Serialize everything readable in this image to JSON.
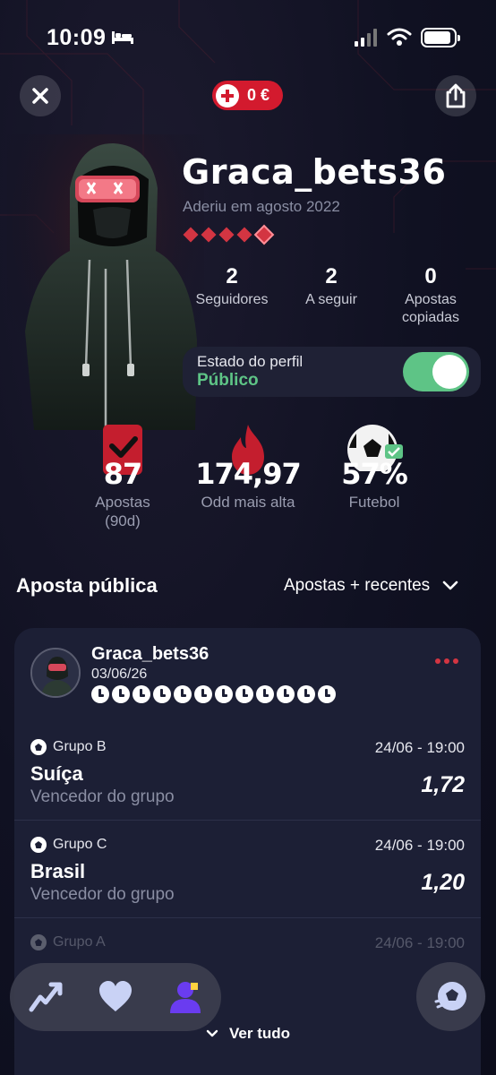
{
  "status_bar": {
    "time": "10:09"
  },
  "header": {
    "balance": "0 €"
  },
  "profile": {
    "username": "Graca_bets36",
    "joined": "Aderiu em agosto 2022",
    "level_filled": 4,
    "level_total": 5
  },
  "stats": [
    {
      "value": "2",
      "label": "Seguidores"
    },
    {
      "value": "2",
      "label": "A seguir"
    },
    {
      "value": "0",
      "label": "Apostas copiadas"
    }
  ],
  "profile_state": {
    "label": "Estado do perfil",
    "value": "Público",
    "toggle_on": true
  },
  "kpis": [
    {
      "value": "87",
      "label": "Apostas (90d)",
      "icon": "ticket-check-icon"
    },
    {
      "value": "174,97",
      "label": "Odd mais alta",
      "icon": "flame-icon"
    },
    {
      "value": "57%",
      "label": "Futebol",
      "icon": "football-icon"
    }
  ],
  "feed": {
    "title": "Aposta pública",
    "sort_label": "Apostas + recentes",
    "see_all": "Ver tudo"
  },
  "bet_card": {
    "user": "Graca_bets36",
    "date": "03/06/26",
    "pending_count": 12,
    "selections": [
      {
        "group": "Grupo B",
        "datetime": "24/06 - 19:00",
        "team": "Suíça",
        "market": "Vencedor do grupo",
        "odd": "1,72"
      },
      {
        "group": "Grupo C",
        "datetime": "24/06 - 19:00",
        "team": "Brasil",
        "market": "Vencedor do grupo",
        "odd": "1,20"
      },
      {
        "group": "Grupo A",
        "datetime": "24/06 - 19:00"
      }
    ]
  },
  "colors": {
    "accent_red": "#d31a2e",
    "accent_green": "#5ec486",
    "background": "#0f1020",
    "card": "#1c1f35"
  }
}
